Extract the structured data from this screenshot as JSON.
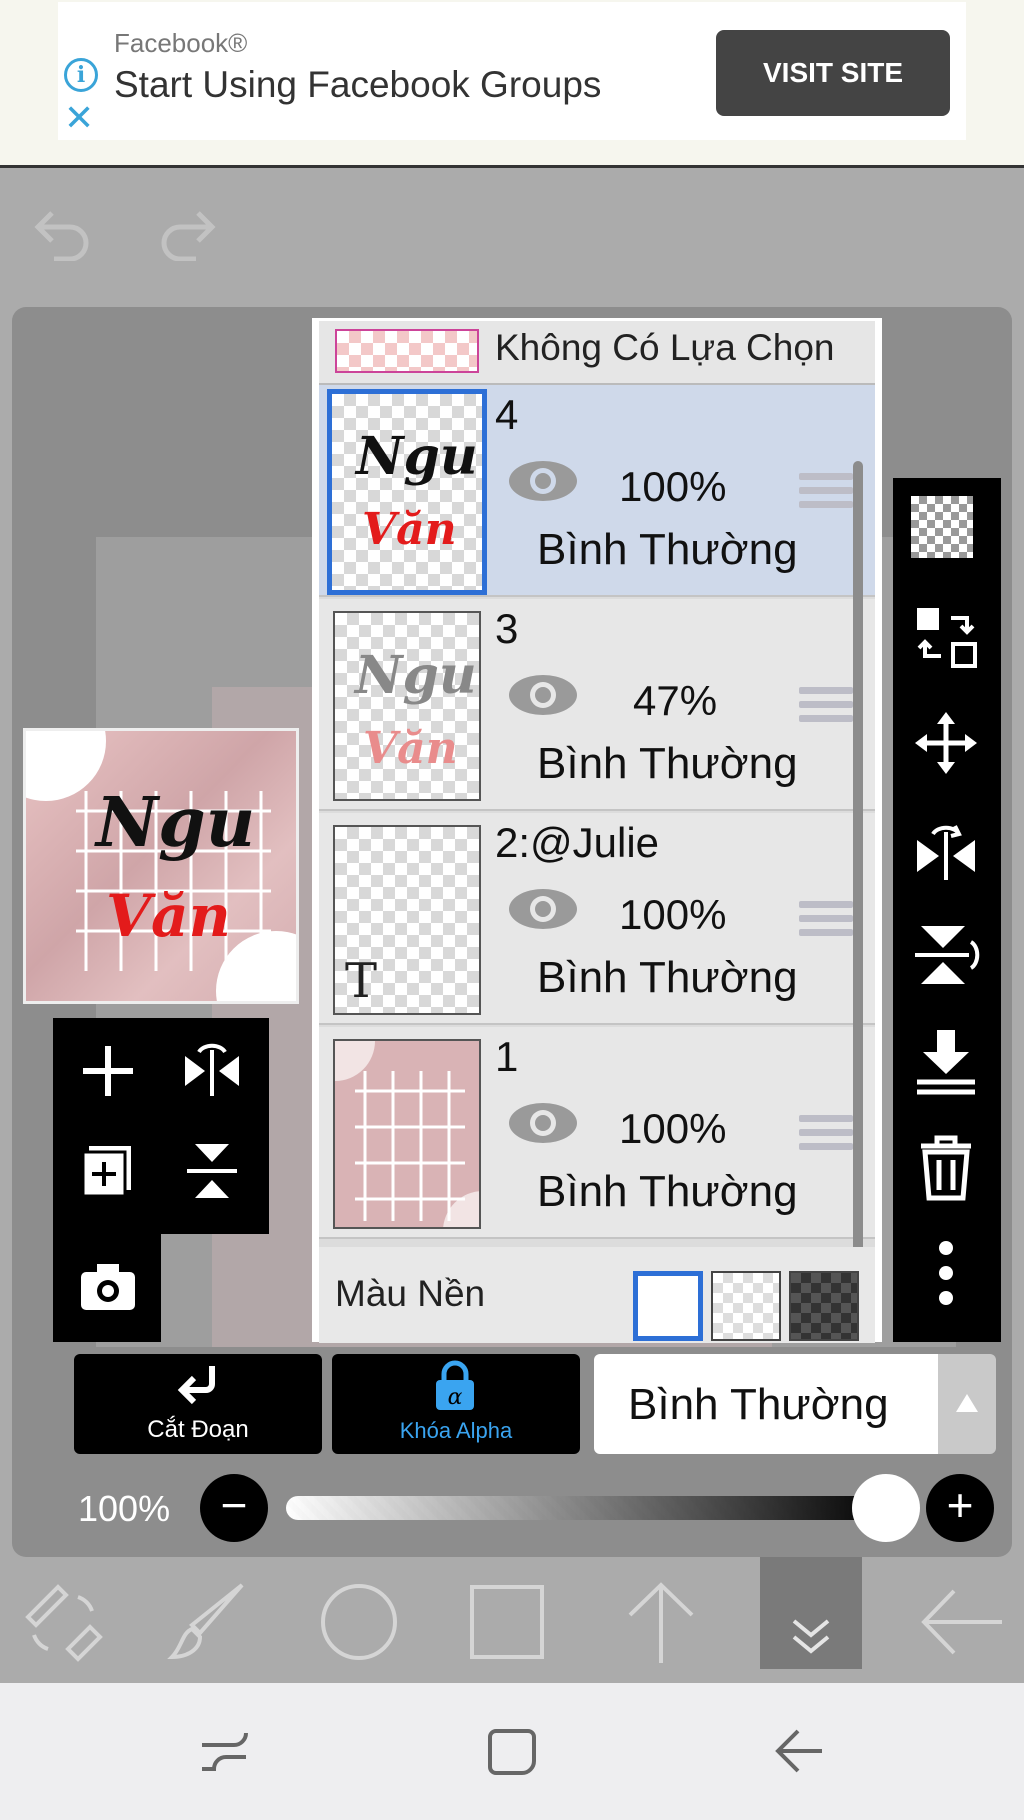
{
  "ad": {
    "source": "Facebook®",
    "title": "Start Using Facebook Groups",
    "button": "VISIT SITE",
    "icons": [
      "info-icon",
      "close-icon"
    ]
  },
  "history": {
    "icons": [
      "undo-icon",
      "redo-icon"
    ]
  },
  "layers_panel": {
    "no_selection": "Không Có Lựa Chọn",
    "layers": [
      {
        "name": "4",
        "opacity": "100%",
        "blend": "Bình Thường",
        "selected": true,
        "content": "Ngu Văn (black/red)"
      },
      {
        "name": "3",
        "opacity": "47%",
        "blend": "Bình Thường",
        "selected": false
      },
      {
        "name": "2:@Julie",
        "opacity": "100%",
        "blend": "Bình Thường",
        "selected": false
      },
      {
        "name": "1",
        "opacity": "100%",
        "blend": "Bình Thường",
        "selected": false
      }
    ],
    "background_label": "Màu Nền",
    "background_options": [
      "white",
      "transparent",
      "dark-checker"
    ],
    "background_selected": "white"
  },
  "preview_art": {
    "line1": "Ngu",
    "line2": "Văn"
  },
  "thumb_text_layer": "T",
  "actions": {
    "clip_label": "Cắt Đoạn",
    "alpha_lock_label": "Khóa Alpha",
    "blend_mode": "Bình Thường"
  },
  "opacity_slider": {
    "label": "100%",
    "value": 100
  },
  "colors": {
    "selected_border": "#2d6fd6",
    "alpha_lock": "#3aa4f0",
    "selected_row": "#cfd9ea"
  }
}
